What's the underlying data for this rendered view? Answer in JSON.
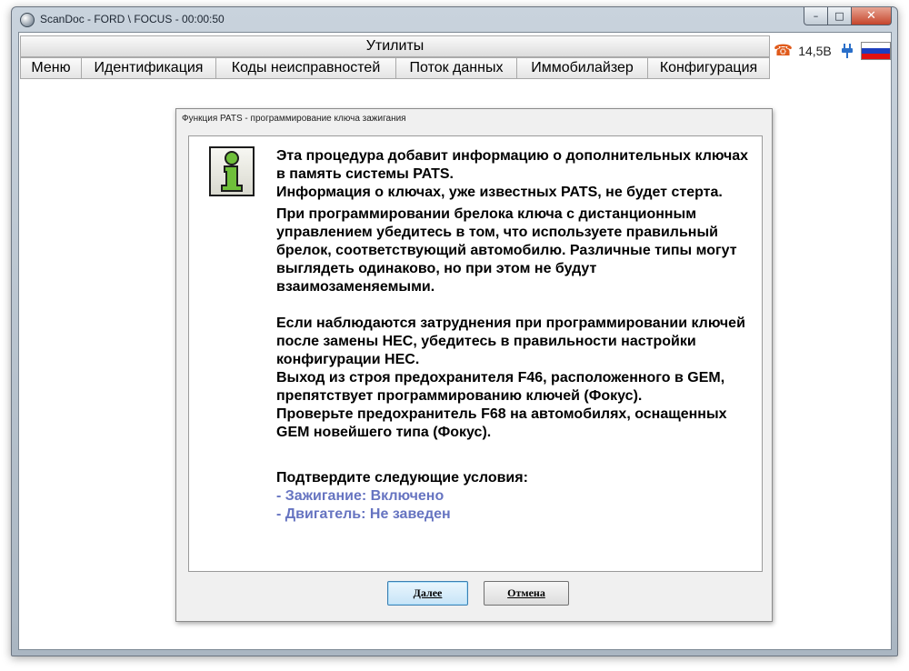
{
  "window": {
    "title": "ScanDoc - FORD \\ FOCUS - 00:00:50",
    "controls": {
      "minimize": "–",
      "maximize": "□",
      "close": "✕"
    }
  },
  "header": {
    "utilities": "Утилиты"
  },
  "menu": {
    "items": [
      {
        "label": "Меню"
      },
      {
        "label": "Идентификация"
      },
      {
        "label": "Коды неисправностей"
      },
      {
        "label": "Поток данных"
      },
      {
        "label": "Иммобилайзер"
      },
      {
        "label": "Конфигурация"
      }
    ]
  },
  "status": {
    "phone_icon": "☎",
    "voltage": "14,5В",
    "flag_colors": [
      "#ffffff",
      "#1d3fbf",
      "#e01010"
    ]
  },
  "dialog": {
    "title": "Функция PATS - программирование ключа зажигания",
    "icon": "info-icon",
    "paragraphs": {
      "p1": "Эта процедура добавит информацию о дополнительных ключах в память системы PATS.",
      "p2": "Информация о ключах, уже известных PATS, не будет стерта.",
      "p3": "При программировании брелока ключа с дистанционным управлением убедитесь в том, что используете правильный брелок, соответствующий автомобилю. Различные типы могут выглядеть одинаково, но при этом не будут взаимозаменяемыми.",
      "p4": "Если наблюдаются затруднения при программировании ключей после замены HEC, убедитесь в правильности настройки конфигурации HEC.",
      "p5": "Выход из строя предохранителя F46, расположенного в GEM, препятствует программированию ключей (Фокус).",
      "p6": "Проверьте предохранитель F68 на автомобилях, оснащенных GEM новейшего типа (Фокус).",
      "confirm": "Подтвердите следующие условия:",
      "cond1": "- Зажигание: Включено",
      "cond2": "- Двигатель: Не заведен"
    },
    "buttons": {
      "next": "Далее",
      "cancel": "Отмена"
    },
    "accent_color": "#6674c1"
  }
}
